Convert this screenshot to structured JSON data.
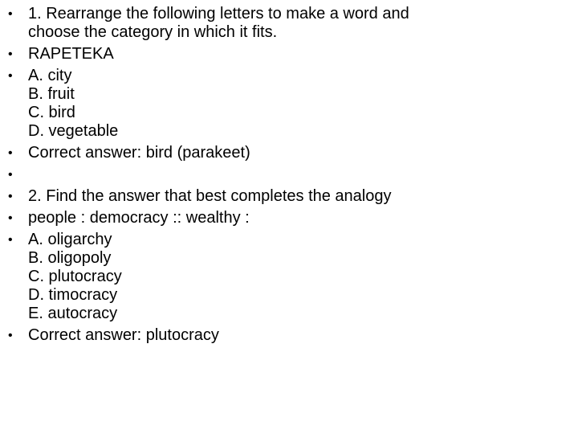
{
  "slide": {
    "items": [
      {
        "lines": [
          "1. Rearrange the following letters to make a word and",
          "choose the category in which it fits."
        ]
      },
      {
        "lines": [
          "RAPETEKA"
        ]
      },
      {
        "lines": [
          "A. city",
          "B. fruit",
          "C. bird",
          "D. vegetable"
        ]
      },
      {
        "lines": [
          "Correct answer: bird (parakeet)"
        ]
      },
      {
        "lines": [
          ""
        ]
      },
      {
        "lines": [
          "2. Find the answer that best completes the analogy"
        ]
      },
      {
        "lines": [
          "people : democracy :: wealthy :"
        ]
      },
      {
        "lines": [
          "A. oligarchy",
          "B. oligopoly",
          "C. plutocracy",
          "D. timocracy",
          "E. autocracy"
        ]
      },
      {
        "lines": [
          "Correct answer: plutocracy"
        ]
      }
    ],
    "bullet_glyph": "•"
  }
}
